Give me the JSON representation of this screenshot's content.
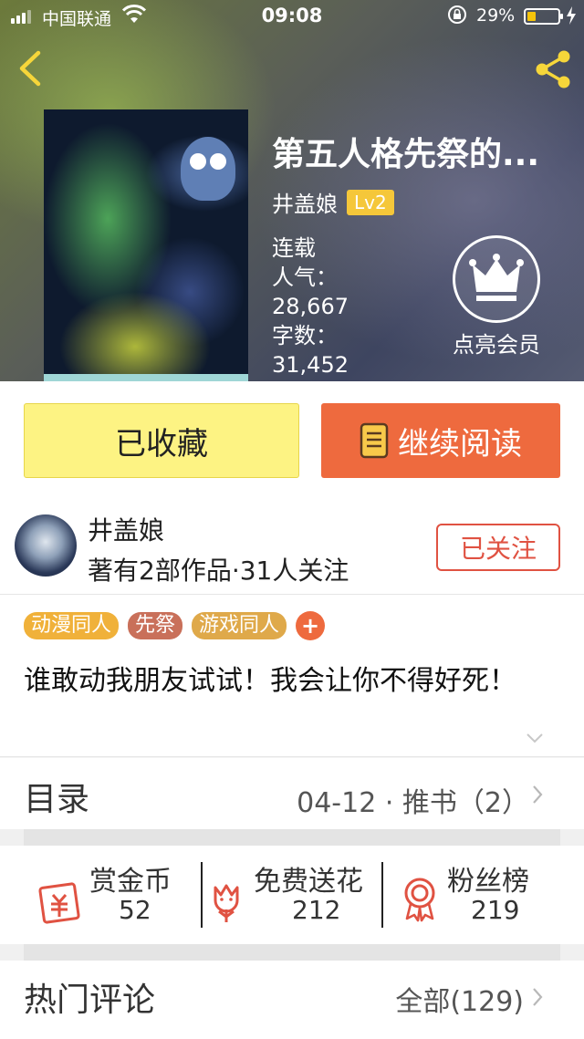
{
  "status_bar": {
    "carrier": "中国联通",
    "time": "09:08",
    "battery": "29%"
  },
  "book": {
    "title": "第五人格先祭的...",
    "author": "井盖娘",
    "level": "Lv2",
    "status": "连载",
    "popularity_label": "人气：",
    "popularity": "28,667",
    "wordcount_label": "字数：",
    "wordcount": "31,452",
    "vip_label": "点亮会员"
  },
  "actions": {
    "collected_label": "已收藏",
    "read_label": "继续阅读"
  },
  "author_block": {
    "name": "井盖娘",
    "stats": "著有2部作品·31人关注",
    "follow_label": "已关注"
  },
  "tags": [
    {
      "label": "动漫同人",
      "color": "#f0b13a"
    },
    {
      "label": "先祭",
      "color": "#c9705a"
    },
    {
      "label": "游戏同人",
      "color": "#dfa94a"
    }
  ],
  "tag_add": "+",
  "intro": "谁敢动我朋友试试！我会让你不得好死！",
  "catalog": {
    "label": "目录",
    "info": "04-12 · 推书（2）"
  },
  "stats": [
    {
      "label": "赏金币",
      "value": "52",
      "icon": "red-envelope-icon"
    },
    {
      "label": "免费送花",
      "value": "212",
      "icon": "flower-icon"
    },
    {
      "label": "粉丝榜",
      "value": "219",
      "icon": "medal-icon"
    }
  ],
  "comments": {
    "label": "热门评论",
    "all": "全部(129)"
  },
  "colors": {
    "accent": "#ee6a3e",
    "collected": "#fdf383",
    "follow": "#e05242",
    "level": "#f5c73a"
  }
}
